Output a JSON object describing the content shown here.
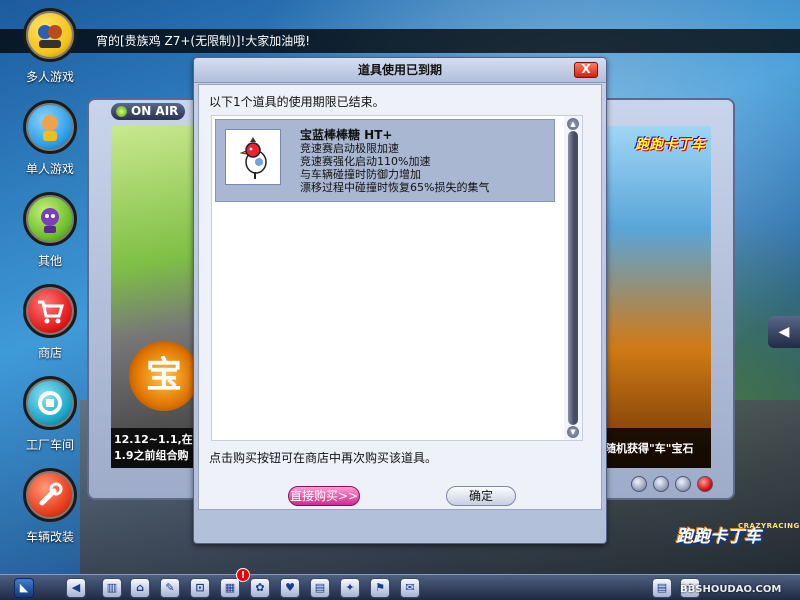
{
  "marquee": {
    "text": "宵的[贵族鸡 Z7+(无限制)]!大家加油哦!"
  },
  "left_nav": [
    {
      "label": "多人游戏",
      "icon": "multiplayer-icon",
      "color": "#f4c21b"
    },
    {
      "label": "单人游戏",
      "icon": "singleplayer-icon",
      "color": "#2b9ee8"
    },
    {
      "label": "其他",
      "icon": "other-icon",
      "color": "#6bbd2a"
    },
    {
      "label": "商店",
      "icon": "shop-cart-icon",
      "color": "#e41a1a"
    },
    {
      "label": "工厂车间",
      "icon": "factory-icon",
      "color": "#1aa5c8"
    },
    {
      "label": "车辆改装",
      "icon": "wrench-icon",
      "color": "#e83b1a"
    }
  ],
  "tv": {
    "onair_label": "ON AIR",
    "caption_left_line1": "12.12~1.1,在",
    "caption_left_line2": "1.9之前组合购",
    "caption_right": "随机获得\"车\"宝石",
    "logo_text": "跑跑卡丁车",
    "coin_text": "宝"
  },
  "brand": {
    "logo": "跑跑卡丁车",
    "crazy": "CRAZYRACING"
  },
  "dialog": {
    "title": "道具使用已到期",
    "close_label": "X",
    "message": "以下1个道具的使用期限已结束。",
    "item": {
      "name": "宝蓝棒棒糖  HT+",
      "icon": "bird-candy-icon",
      "effects": [
        "竞速赛启动极限加速",
        "竞速赛强化启动110%加速",
        "与车辆碰撞时防御力增加",
        "漂移过程中碰撞时恢复65%损失的集气"
      ]
    },
    "hint": "点击购买按钮可在商店中再次购买该道具。",
    "buy_label": "直接购买>>",
    "ok_label": "确定"
  },
  "taskbar": {
    "alert": "!",
    "buttons": [
      "◀",
      "▥",
      "⌂",
      "✎",
      "⊡",
      "▦",
      "✿",
      "♥",
      "▤",
      "✦",
      "⚑",
      "✉",
      "▤",
      "★"
    ]
  },
  "watermark": "BBSHOUDAO.COM"
}
